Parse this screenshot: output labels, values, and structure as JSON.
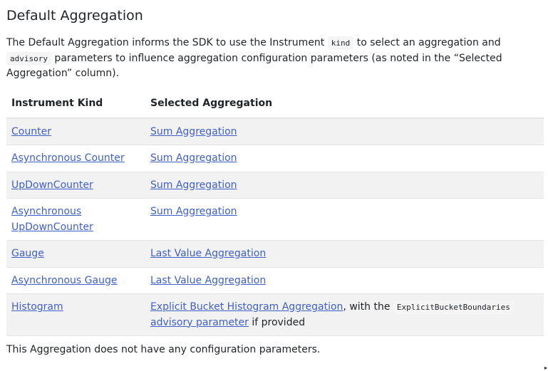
{
  "heading": "Default Aggregation",
  "intro": {
    "part1": "The Default Aggregation informs the SDK to use the Instrument ",
    "code1": "kind",
    "part2": " to select an aggregation and ",
    "code2": "advisory",
    "part3": " parameters to influence aggregation configuration parameters (as noted in the “Selected Aggregation” column)."
  },
  "table": {
    "headers": [
      "Instrument Kind",
      "Selected Aggregation"
    ],
    "rows": [
      {
        "kind": "Counter",
        "aggregation": "Sum Aggregation"
      },
      {
        "kind": "Asynchronous Counter",
        "aggregation": "Sum Aggregation"
      },
      {
        "kind": "UpDownCounter",
        "aggregation": "Sum Aggregation"
      },
      {
        "kind": "Asynchronous UpDownCounter",
        "aggregation": "Sum Aggregation"
      },
      {
        "kind": "Gauge",
        "aggregation": "Last Value Aggregation"
      },
      {
        "kind": "Asynchronous Gauge",
        "aggregation": "Last Value Aggregation"
      },
      {
        "kind": "Histogram",
        "aggregation": "Explicit Bucket Histogram Aggregation",
        "with_text": ", with the ",
        "code": "ExplicitBucketBoundaries",
        "link2": "advisory parameter",
        "suffix": " if provided"
      }
    ]
  },
  "outro": "This Aggregation does not have any configuration parameters.",
  "colors": {
    "link": "#3f5fc7",
    "row_stripe": "#f2f2f2",
    "border": "#e3e3e3",
    "text": "#212529"
  },
  "corner_glyph": "▸"
}
